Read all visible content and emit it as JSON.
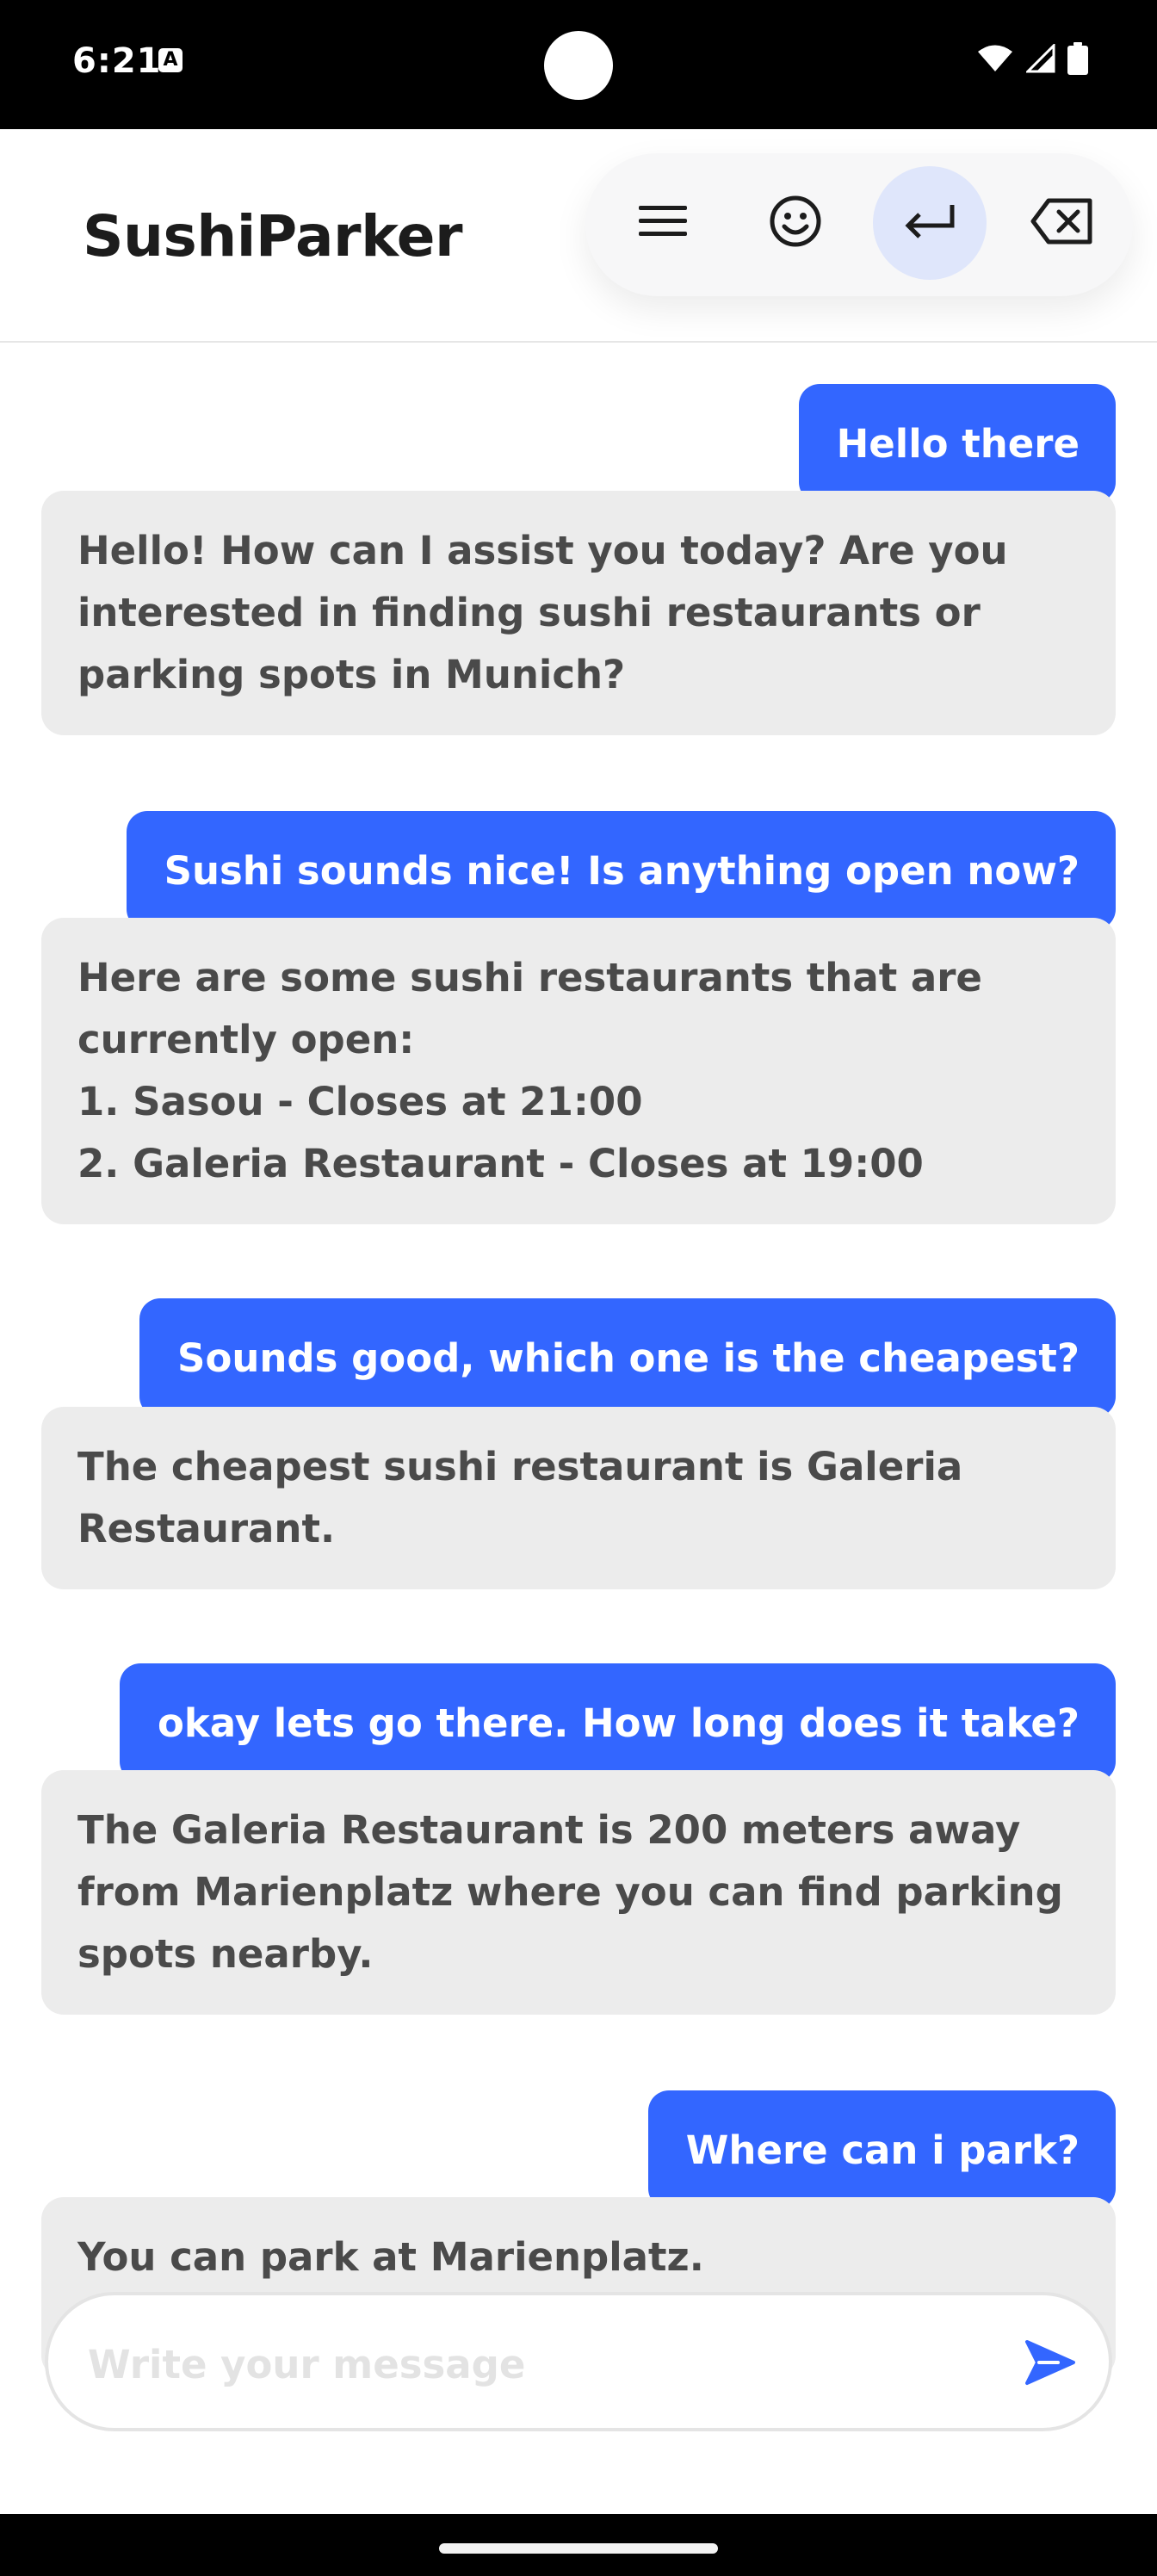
{
  "status_bar": {
    "time": "6:21",
    "notification_icon": "a-icon",
    "icons": [
      "wifi-icon",
      "signal-icon",
      "battery-icon"
    ]
  },
  "header": {
    "title": "SushiParker",
    "toolbar": [
      {
        "name": "menu-icon"
      },
      {
        "name": "emoji-icon"
      },
      {
        "name": "enter-icon",
        "active": true
      },
      {
        "name": "backspace-icon"
      }
    ]
  },
  "messages": [
    {
      "role": "user",
      "text": "Hello there"
    },
    {
      "role": "bot",
      "text": "Hello! How can I assist you today? Are you interested in finding sushi restaurants or parking spots in Munich?"
    },
    {
      "role": "user",
      "text": "Sushi sounds nice! Is anything open now?"
    },
    {
      "role": "bot",
      "text": "Here are some sushi restaurants that are currently open:\n1. Sasou - Closes at 21:00\n2. Galeria Restaurant - Closes at 19:00"
    },
    {
      "role": "user",
      "text": "Sounds good, which one is the cheapest?"
    },
    {
      "role": "bot",
      "text": "The cheapest sushi restaurant is Galeria Restaurant."
    },
    {
      "role": "user",
      "text": "okay lets go there. How long does it take?"
    },
    {
      "role": "bot",
      "text": "The Galeria Restaurant is 200 meters away from Marienplatz where you can find parking spots nearby."
    },
    {
      "role": "user",
      "text": "Where can i park?"
    },
    {
      "role": "bot",
      "text": "You can park at Marienplatz."
    }
  ],
  "composer": {
    "placeholder": "Write your message",
    "value": ""
  },
  "colors": {
    "accent": "#3366ff",
    "bot_bubble": "#ececec",
    "bot_text": "#4a4a4a",
    "toolbar_active": "#dfe6fb"
  }
}
